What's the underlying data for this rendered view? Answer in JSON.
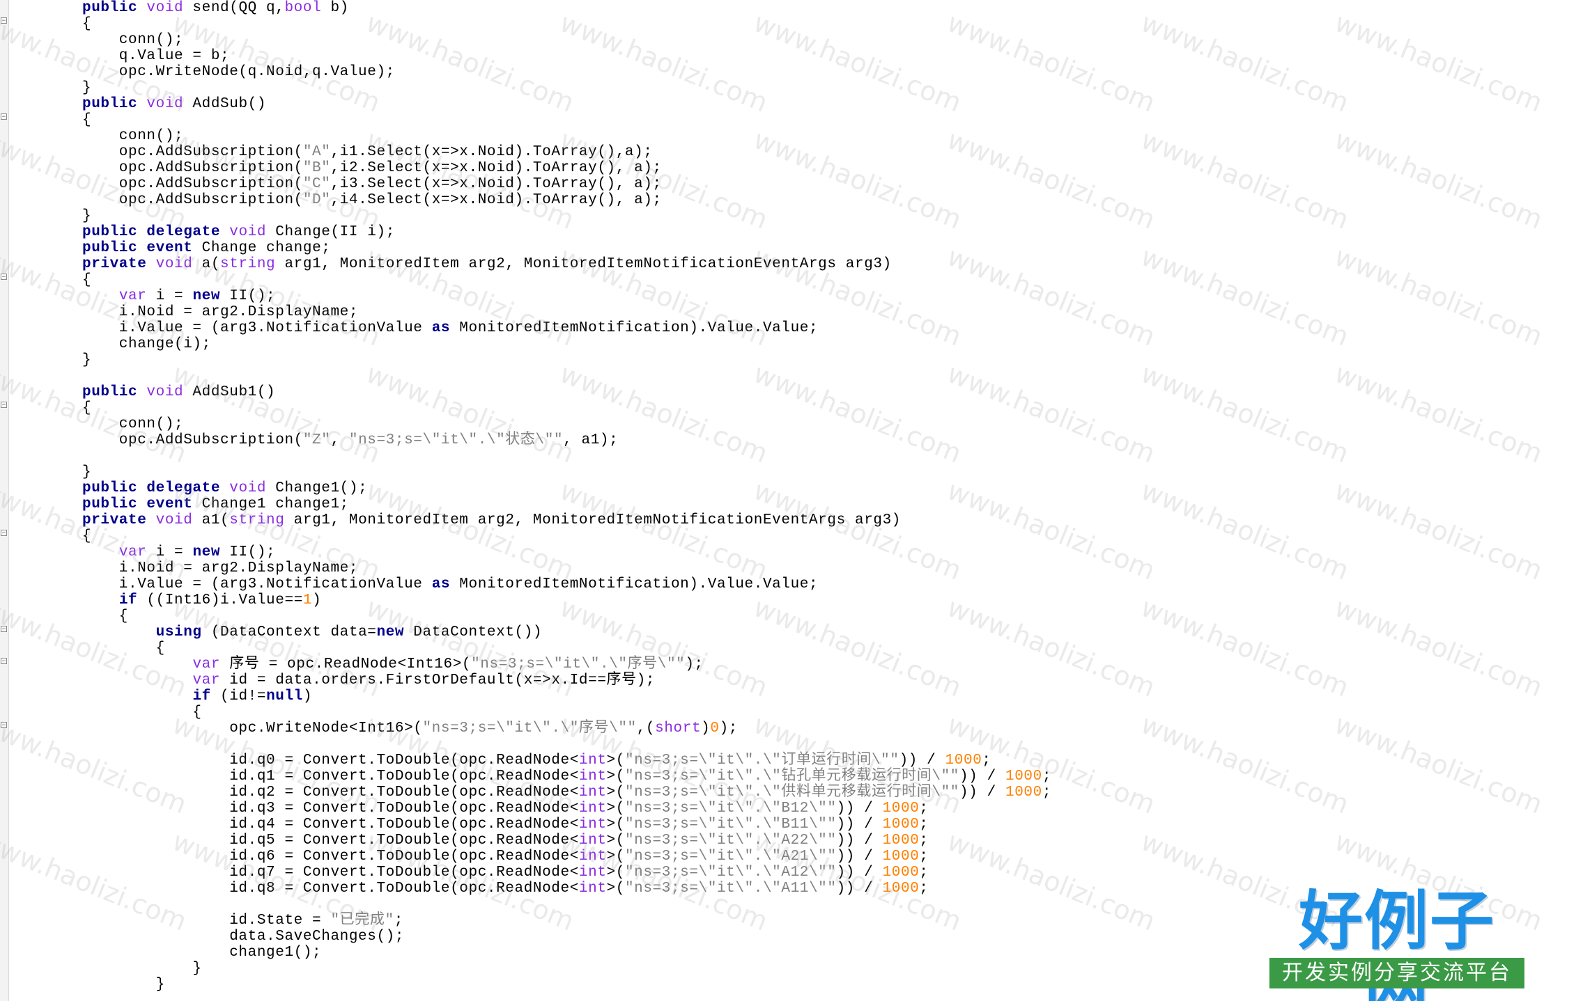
{
  "code_lines": [
    [
      [
        "public",
        "kw"
      ],
      [
        " ",
        "pl"
      ],
      [
        "void",
        "ty"
      ],
      [
        " send(QQ q,",
        "pl"
      ],
      [
        "bool",
        "ty"
      ],
      [
        " b)",
        "pl"
      ]
    ],
    [
      [
        "{",
        "pl"
      ]
    ],
    [
      [
        "    conn();",
        "pl"
      ]
    ],
    [
      [
        "    q.Value = b;",
        "pl"
      ]
    ],
    [
      [
        "    opc.WriteNode(q.Noid,q.Value);",
        "pl"
      ]
    ],
    [
      [
        "}",
        "pl"
      ]
    ],
    [
      [
        "public",
        "kw"
      ],
      [
        " ",
        "pl"
      ],
      [
        "void",
        "ty"
      ],
      [
        " AddSub()",
        "pl"
      ]
    ],
    [
      [
        "{",
        "pl"
      ]
    ],
    [
      [
        "    conn();",
        "pl"
      ]
    ],
    [
      [
        "    opc.AddSubscription(",
        "pl"
      ],
      [
        "\"A\"",
        "st"
      ],
      [
        ",i1.Select(x=>x.Noid).ToArray(),a);",
        "pl"
      ]
    ],
    [
      [
        "    opc.AddSubscription(",
        "pl"
      ],
      [
        "\"B\"",
        "st"
      ],
      [
        ",i2.Select(x=>x.Noid).ToArray(), a);",
        "pl"
      ]
    ],
    [
      [
        "    opc.AddSubscription(",
        "pl"
      ],
      [
        "\"C\"",
        "st"
      ],
      [
        ",i3.Select(x=>x.Noid).ToArray(), a);",
        "pl"
      ]
    ],
    [
      [
        "    opc.AddSubscription(",
        "pl"
      ],
      [
        "\"D\"",
        "st"
      ],
      [
        ",i4.Select(x=>x.Noid).ToArray(), a);",
        "pl"
      ]
    ],
    [
      [
        "}",
        "pl"
      ]
    ],
    [
      [
        "public",
        "kw"
      ],
      [
        " ",
        "pl"
      ],
      [
        "delegate",
        "kw"
      ],
      [
        " ",
        "pl"
      ],
      [
        "void",
        "ty"
      ],
      [
        " Change(II i);",
        "pl"
      ]
    ],
    [
      [
        "public",
        "kw"
      ],
      [
        " ",
        "pl"
      ],
      [
        "event",
        "kw"
      ],
      [
        " Change change;",
        "pl"
      ]
    ],
    [
      [
        "private",
        "kw"
      ],
      [
        " ",
        "pl"
      ],
      [
        "void",
        "ty"
      ],
      [
        " a(",
        "pl"
      ],
      [
        "string",
        "ty"
      ],
      [
        " arg1, MonitoredItem arg2, MonitoredItemNotificationEventArgs arg3)",
        "pl"
      ]
    ],
    [
      [
        "{",
        "pl"
      ]
    ],
    [
      [
        "    ",
        "pl"
      ],
      [
        "var",
        "ty"
      ],
      [
        " i = ",
        "pl"
      ],
      [
        "new",
        "kw"
      ],
      [
        " II();",
        "pl"
      ]
    ],
    [
      [
        "    i.Noid = arg2.DisplayName;",
        "pl"
      ]
    ],
    [
      [
        "    i.Value = (arg3.NotificationValue ",
        "pl"
      ],
      [
        "as",
        "kw"
      ],
      [
        " MonitoredItemNotification).Value.Value;",
        "pl"
      ]
    ],
    [
      [
        "    change(i);",
        "pl"
      ]
    ],
    [
      [
        "}",
        "pl"
      ]
    ],
    [
      [
        "",
        "pl"
      ]
    ],
    [
      [
        "public",
        "kw"
      ],
      [
        " ",
        "pl"
      ],
      [
        "void",
        "ty"
      ],
      [
        " AddSub1()",
        "pl"
      ]
    ],
    [
      [
        "{",
        "pl"
      ]
    ],
    [
      [
        "    conn();",
        "pl"
      ]
    ],
    [
      [
        "    opc.AddSubscription(",
        "pl"
      ],
      [
        "\"Z\"",
        "st"
      ],
      [
        ", ",
        "pl"
      ],
      [
        "\"ns=3;s=\\\"it\\\".\\\"状态\\\"\"",
        "st"
      ],
      [
        ", a1);",
        "pl"
      ]
    ],
    [
      [
        "",
        "pl"
      ]
    ],
    [
      [
        "}",
        "pl"
      ]
    ],
    [
      [
        "public",
        "kw"
      ],
      [
        " ",
        "pl"
      ],
      [
        "delegate",
        "kw"
      ],
      [
        " ",
        "pl"
      ],
      [
        "void",
        "ty"
      ],
      [
        " Change1();",
        "pl"
      ]
    ],
    [
      [
        "public",
        "kw"
      ],
      [
        " ",
        "pl"
      ],
      [
        "event",
        "kw"
      ],
      [
        " Change1 change1;",
        "pl"
      ]
    ],
    [
      [
        "private",
        "kw"
      ],
      [
        " ",
        "pl"
      ],
      [
        "void",
        "ty"
      ],
      [
        " a1(",
        "pl"
      ],
      [
        "string",
        "ty"
      ],
      [
        " arg1, MonitoredItem arg2, MonitoredItemNotificationEventArgs arg3)",
        "pl"
      ]
    ],
    [
      [
        "{",
        "pl"
      ]
    ],
    [
      [
        "    ",
        "pl"
      ],
      [
        "var",
        "ty"
      ],
      [
        " i = ",
        "pl"
      ],
      [
        "new",
        "kw"
      ],
      [
        " II();",
        "pl"
      ]
    ],
    [
      [
        "    i.Noid = arg2.DisplayName;",
        "pl"
      ]
    ],
    [
      [
        "    i.Value = (arg3.NotificationValue ",
        "pl"
      ],
      [
        "as",
        "kw"
      ],
      [
        " MonitoredItemNotification).Value.Value;",
        "pl"
      ]
    ],
    [
      [
        "    ",
        "pl"
      ],
      [
        "if",
        "kw"
      ],
      [
        " ((Int16)i.Value==",
        "pl"
      ],
      [
        "1",
        "nm"
      ],
      [
        ")",
        "pl"
      ]
    ],
    [
      [
        "    {",
        "pl"
      ]
    ],
    [
      [
        "        ",
        "pl"
      ],
      [
        "using",
        "kw"
      ],
      [
        " (DataContext data=",
        "pl"
      ],
      [
        "new",
        "kw"
      ],
      [
        " DataContext())",
        "pl"
      ]
    ],
    [
      [
        "        {",
        "pl"
      ]
    ],
    [
      [
        "            ",
        "pl"
      ],
      [
        "var",
        "ty"
      ],
      [
        " 序号 = opc.ReadNode<Int16>(",
        "pl"
      ],
      [
        "\"ns=3;s=\\\"it\\\".\\\"序号\\\"\"",
        "st"
      ],
      [
        ");",
        "pl"
      ]
    ],
    [
      [
        "            ",
        "pl"
      ],
      [
        "var",
        "ty"
      ],
      [
        " id = data.orders.FirstOrDefault(x=>x.Id==序号);",
        "pl"
      ]
    ],
    [
      [
        "            ",
        "pl"
      ],
      [
        "if",
        "kw"
      ],
      [
        " (id!=",
        "pl"
      ],
      [
        "null",
        "kw"
      ],
      [
        ")",
        "pl"
      ]
    ],
    [
      [
        "            {",
        "pl"
      ]
    ],
    [
      [
        "                opc.WriteNode<Int16>(",
        "pl"
      ],
      [
        "\"ns=3;s=\\\"it\\\".\\\"序号\\\"\"",
        "st"
      ],
      [
        ",(",
        "pl"
      ],
      [
        "short",
        "ty"
      ],
      [
        ")",
        "pl"
      ],
      [
        "0",
        "nm"
      ],
      [
        ");",
        "pl"
      ]
    ],
    [
      [
        "",
        "pl"
      ]
    ],
    [
      [
        "                id.q0 = Convert.ToDouble(opc.ReadNode<",
        "pl"
      ],
      [
        "int",
        "ty"
      ],
      [
        ">(",
        "pl"
      ],
      [
        "\"ns=3;s=\\\"it\\\".\\\"订单运行时间\\\"\"",
        "st"
      ],
      [
        ")) / ",
        "pl"
      ],
      [
        "1000",
        "nm"
      ],
      [
        ";",
        "pl"
      ]
    ],
    [
      [
        "                id.q1 = Convert.ToDouble(opc.ReadNode<",
        "pl"
      ],
      [
        "int",
        "ty"
      ],
      [
        ">(",
        "pl"
      ],
      [
        "\"ns=3;s=\\\"it\\\".\\\"钻孔单元移载运行时间\\\"\"",
        "st"
      ],
      [
        ")) / ",
        "pl"
      ],
      [
        "1000",
        "nm"
      ],
      [
        ";",
        "pl"
      ]
    ],
    [
      [
        "                id.q2 = Convert.ToDouble(opc.ReadNode<",
        "pl"
      ],
      [
        "int",
        "ty"
      ],
      [
        ">(",
        "pl"
      ],
      [
        "\"ns=3;s=\\\"it\\\".\\\"供料单元移载运行时间\\\"\"",
        "st"
      ],
      [
        ")) / ",
        "pl"
      ],
      [
        "1000",
        "nm"
      ],
      [
        ";",
        "pl"
      ]
    ],
    [
      [
        "                id.q3 = Convert.ToDouble(opc.ReadNode<",
        "pl"
      ],
      [
        "int",
        "ty"
      ],
      [
        ">(",
        "pl"
      ],
      [
        "\"ns=3;s=\\\"it\\\".\\\"B12\\\"\"",
        "st"
      ],
      [
        ")) / ",
        "pl"
      ],
      [
        "1000",
        "nm"
      ],
      [
        ";",
        "pl"
      ]
    ],
    [
      [
        "                id.q4 = Convert.ToDouble(opc.ReadNode<",
        "pl"
      ],
      [
        "int",
        "ty"
      ],
      [
        ">(",
        "pl"
      ],
      [
        "\"ns=3;s=\\\"it\\\".\\\"B11\\\"\"",
        "st"
      ],
      [
        ")) / ",
        "pl"
      ],
      [
        "1000",
        "nm"
      ],
      [
        ";",
        "pl"
      ]
    ],
    [
      [
        "                id.q5 = Convert.ToDouble(opc.ReadNode<",
        "pl"
      ],
      [
        "int",
        "ty"
      ],
      [
        ">(",
        "pl"
      ],
      [
        "\"ns=3;s=\\\"it\\\".\\\"A22\\\"\"",
        "st"
      ],
      [
        ")) / ",
        "pl"
      ],
      [
        "1000",
        "nm"
      ],
      [
        ";",
        "pl"
      ]
    ],
    [
      [
        "                id.q6 = Convert.ToDouble(opc.ReadNode<",
        "pl"
      ],
      [
        "int",
        "ty"
      ],
      [
        ">(",
        "pl"
      ],
      [
        "\"ns=3;s=\\\"it\\\".\\\"A21\\\"\"",
        "st"
      ],
      [
        ")) / ",
        "pl"
      ],
      [
        "1000",
        "nm"
      ],
      [
        ";",
        "pl"
      ]
    ],
    [
      [
        "                id.q7 = Convert.ToDouble(opc.ReadNode<",
        "pl"
      ],
      [
        "int",
        "ty"
      ],
      [
        ">(",
        "pl"
      ],
      [
        "\"ns=3;s=\\\"it\\\".\\\"A12\\\"\"",
        "st"
      ],
      [
        ")) / ",
        "pl"
      ],
      [
        "1000",
        "nm"
      ],
      [
        ";",
        "pl"
      ]
    ],
    [
      [
        "                id.q8 = Convert.ToDouble(opc.ReadNode<",
        "pl"
      ],
      [
        "int",
        "ty"
      ],
      [
        ">(",
        "pl"
      ],
      [
        "\"ns=3;s=\\\"it\\\".\\\"A11\\\"\"",
        "st"
      ],
      [
        ")) / ",
        "pl"
      ],
      [
        "1000",
        "nm"
      ],
      [
        ";",
        "pl"
      ]
    ],
    [
      [
        "",
        "pl"
      ]
    ],
    [
      [
        "                id.State = ",
        "pl"
      ],
      [
        "\"已完成\"",
        "st"
      ],
      [
        ";",
        "pl"
      ]
    ],
    [
      [
        "                data.SaveChanges();",
        "pl"
      ]
    ],
    [
      [
        "                change1();",
        "pl"
      ]
    ],
    [
      [
        "            }",
        "pl"
      ]
    ],
    [
      [
        "        }",
        "pl"
      ]
    ]
  ],
  "colors": {
    "keyword": "#00008b",
    "type": "#8a2be2",
    "string": "#808080",
    "number": "#ff8000",
    "plain": "#000000"
  },
  "watermark": {
    "text": "www.haolizi.com"
  },
  "logo": {
    "title": "好例子网",
    "subtitle": "开发实例分享交流平台"
  }
}
